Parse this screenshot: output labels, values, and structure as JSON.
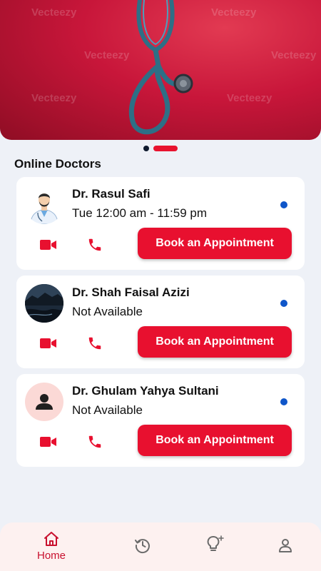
{
  "banner": {
    "watermark": "Vecteezy"
  },
  "section_title": "Online Doctors",
  "doctors": [
    {
      "name": "Dr. Rasul Safi",
      "schedule": "Tue 12:00 am - 11:59 pm",
      "book_label": "Book an Appointment"
    },
    {
      "name": "Dr. Shah Faisal Azizi",
      "schedule": "Not Available",
      "book_label": "Book an Appointment"
    },
    {
      "name": "Dr. Ghulam Yahya Sultani",
      "schedule": "Not Available",
      "book_label": "Book an Appointment"
    }
  ],
  "nav": {
    "home_label": "Home"
  },
  "colors": {
    "accent": "#e8102f",
    "status_dot": "#0f56c9",
    "nav_bg": "#fdf1f0",
    "page_bg": "#eef1f7"
  }
}
